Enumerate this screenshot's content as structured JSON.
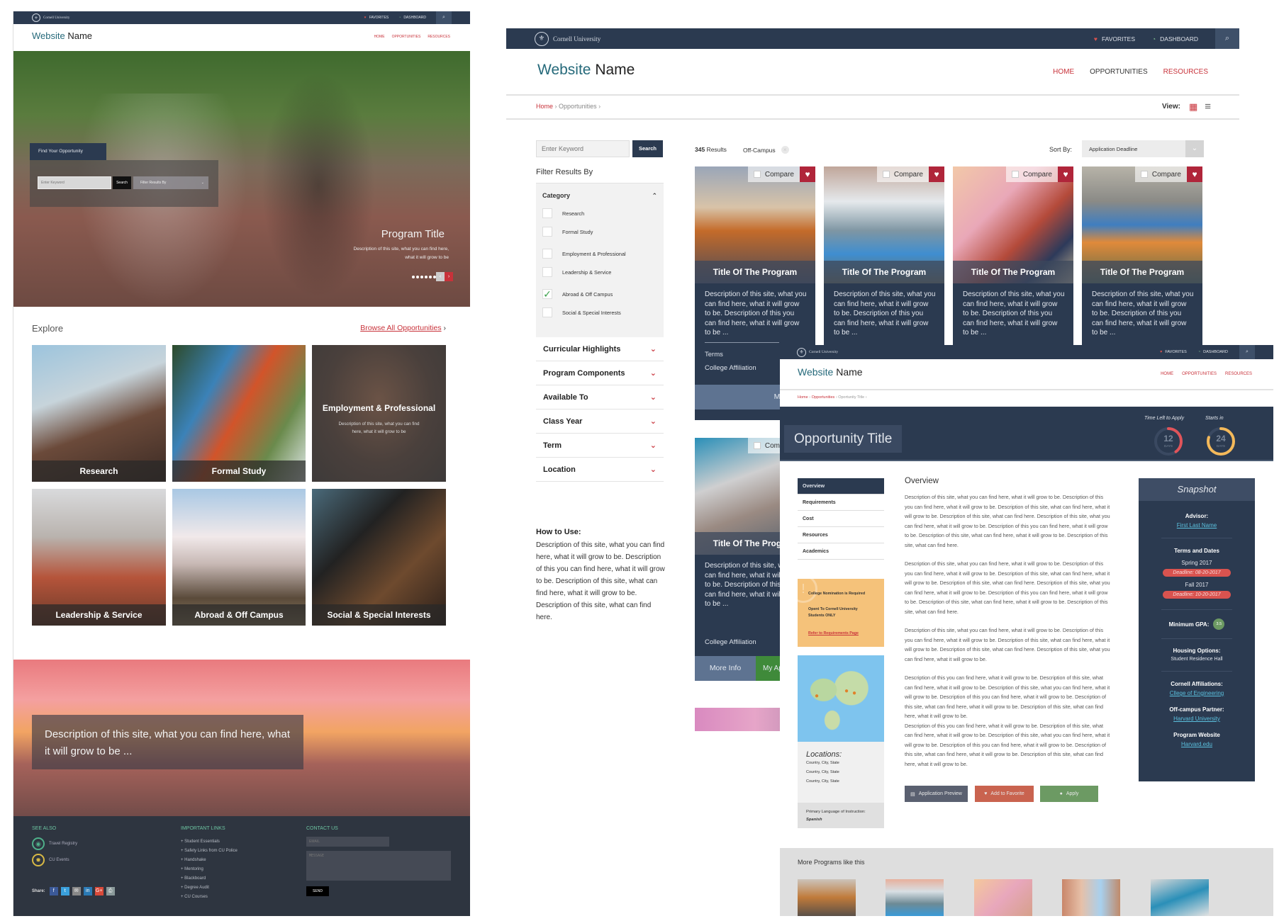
{
  "university": "Cornell University",
  "site": {
    "brand_first": "Website",
    "brand_second": "Name"
  },
  "topbar": {
    "favorites": "FAVORITES",
    "dashboard": "DASHBOARD"
  },
  "nav": [
    "HOME",
    "OPPORTUNITIES",
    "RESOURCES"
  ],
  "colors": {
    "navy": "#2b3a50",
    "accent_red": "#c8323a",
    "teal": "#25697a",
    "warning": "#f5c27a",
    "success": "#6c9a63",
    "link_cyan": "#5bc0de"
  },
  "home": {
    "search_panel": {
      "title": "Find Your Opportunity",
      "keyword_placeholder": "Enter Keyword",
      "search_label": "Search",
      "filter_placeholder": "Filter Results By"
    },
    "hero": {
      "title": "Program Title",
      "description": "Description of this site, what you can find here, what it will grow to be",
      "slides": 6,
      "active_slide": 0
    },
    "explore": {
      "title": "Explore",
      "browse_all": "Browse All Opportunities",
      "tiles": [
        {
          "label": "Research"
        },
        {
          "label": "Formal Study"
        },
        {
          "label": "Employment & Professional",
          "description": "Description of this site, what you can find here, what it will grow to be"
        },
        {
          "label": "Leadership & Service"
        },
        {
          "label": "Abroad & Off Campus"
        },
        {
          "label": "Social & Special Interests"
        }
      ]
    },
    "banner": {
      "text": "Description of this site, what you can find here, what it will grow to be ..."
    },
    "footer": {
      "see_also": {
        "title": "SEE ALSO",
        "items": [
          "Travel Registry",
          "CU Events"
        ]
      },
      "share_label": "Share:",
      "share_icons": [
        "f",
        "t",
        "✉",
        "in",
        "G+",
        "⎙"
      ],
      "important_links": {
        "title": "IMPORTANT LINKS",
        "items": [
          "Student Essentials",
          "Safety Links from CU Police",
          "Handshake",
          "Mentoring",
          "Blackboard",
          "Degree Audit",
          "CU Courses"
        ]
      },
      "contact": {
        "title": "CONTACT US",
        "email_placeholder": "EMAIL",
        "message_placeholder": "MESSAGE",
        "send": "SEND"
      }
    }
  },
  "listing": {
    "breadcrumb": [
      "Home",
      "Opportunities"
    ],
    "view_label": "View:",
    "search": {
      "placeholder": "Enter Keyword",
      "button": "Search"
    },
    "filter_title": "Filter Results By",
    "category": {
      "title": "Category",
      "options": [
        {
          "label": "Research",
          "checked": false
        },
        {
          "label": "Formal Study",
          "checked": false
        },
        {
          "label": "Employment & Professional",
          "checked": false
        },
        {
          "label": "Leadership & Service",
          "checked": false
        },
        {
          "label": "Abroad & Off Campus",
          "checked": true
        },
        {
          "label": "Social & Special Interests",
          "checked": false
        }
      ]
    },
    "collapsed_filters": [
      "Curricular Highlights",
      "Program Components",
      "Available To",
      "Class Year",
      "Term",
      "Location"
    ],
    "how_to": {
      "title": "How to Use:",
      "text": "Description of this site, what you can find here, what it will grow to be. Description of this you can find here, what it will grow to be. Description of this site, what can find here, what it will grow to be. Description of this site, what can find here."
    },
    "results_count": "345",
    "results_label": "Results",
    "active_filter": "Off-Campus",
    "sort_label": "Sort By:",
    "sort_value": "Application Deadline",
    "cards": [
      {
        "title": "Title Of The Program",
        "description": "Description of this site, what you can find here, what it will grow to be. Description of this you can find here, what it will grow to be ...",
        "compare": "Compare",
        "compare_checked": false
      },
      {
        "title": "Title Of The Program",
        "description": "Description of this site, what you can find here, what it will grow to be. Description of this you can find here, what it will grow to be ...",
        "compare": "Compare",
        "compare_checked": false
      },
      {
        "title": "Title Of The Program",
        "description": "Description of this site, what you can find here, what it will grow to be. Description of this you can find here, what it will grow to be ...",
        "compare": "Compare",
        "compare_checked": false
      },
      {
        "title": "Title Of The Program",
        "description": "Description of this site, what you can find here, what it will grow to be. Description of this you can find here, what it will grow to be ...",
        "compare": "Compare",
        "compare_checked": false
      },
      {
        "title": "Title Of The Program",
        "description": "Description of this site, what you can find here, what it will grow to be. Description of this you can find here, what it will grow to be ...",
        "compare": "Compare",
        "compare_checked": false
      },
      {
        "title": "",
        "compare": "Compare",
        "compare_checked": true
      }
    ],
    "card_meta": {
      "terms": "Terms",
      "college": "College Affiliation",
      "more_info": "More Info",
      "my_app": "My Ap"
    }
  },
  "detail": {
    "breadcrumb": [
      "Home",
      "Opportunities",
      "Oportunity Title"
    ],
    "title": "Opportunity Title",
    "time_left": {
      "label": "Time Left to Apply",
      "value": "12",
      "unit": "DAYS",
      "fraction": 0.4
    },
    "starts_in": {
      "label": "Starts in",
      "value": "24",
      "unit": "DAYS",
      "fraction": 0.8
    },
    "sidenav": [
      "Overview",
      "Requirements",
      "Cost",
      "Resources",
      "Academics"
    ],
    "alert": {
      "line1": "College Nomination is Required",
      "line2": "Opent To Cornell University Students ONLY",
      "link": "Refer to Requirements Page"
    },
    "locations": {
      "title": "Locations:",
      "items": [
        "Country, City, State",
        "Country, City, State",
        "Country, City, State"
      ]
    },
    "language": {
      "label": "Primary Language of Instruction:",
      "value": "Spanish"
    },
    "overview_title": "Overview",
    "paragraphs": [
      "Description of this site, what you can find here, what it will grow to be. Description of this you can find here, what it will grow to be. Description of this site, what can find here, what it will grow to be. Description of this site, what can find here. Description of this site, what you can find here, what it will grow to be. Description of this you can find here, what it will grow to be. Description of this site, what can find here, what it will grow to be. Description of this site, what can find here.",
      "Description of this site, what you can find here, what it will grow to be. Description of this you can find here, what it will grow to be. Description of this site, what can find here, what it will grow to be. Description of this site, what can find here. Description of this site, what you can find here, what it will grow to be. Description of this you can find here, what it will grow to be. Description of this site, what can find here, what it will grow to be. Description of this site, what can find here.",
      "Description of this site, what you can find here, what it will grow to be. Description of this you can find here, what it will grow to be. Description of this site, what can find here, what it will grow to be. Description of this site, what can find here. Description of this site, what you can find here, what it will grow to be.",
      "Description of this you can find here, what it will grow to be. Description of this site, what can find here, what it will grow to be. Description of this site, what you can find here, what it will grow to be. Description of this you can find here, what it will grow to be. Description of this site, what can find here, what it will grow to be.  Description of this site, what can find here, what it will grow to be.",
      "Description of this you can find here, what it will grow to be. Description of this site, what can find here, what it will grow to be. Description of this site, what you can find here, what it will grow to be. Description of this you can find here, what it will grow to be. Description of this site, what can find here, what it will grow to be.  Description of this site, what can find here, what it will grow to be."
    ],
    "buttons": {
      "preview": "Application Preview",
      "favorite": "Add to Favorite",
      "apply": "Apply"
    },
    "snapshot": {
      "title": "Snapshot",
      "advisor_label": "Advisor:",
      "advisor": "First Last Name",
      "terms_label": "Terms and Dates",
      "terms": [
        {
          "term": "Spring 2017",
          "deadline": "Deadline: 08-20-2017"
        },
        {
          "term": "Fall 2017",
          "deadline": "Deadline: 10-20-2017"
        }
      ],
      "gpa_label": "Minimum GPA:",
      "gpa": "3.5",
      "housing_label": "Housing Options:",
      "housing": "Student Residence Hall",
      "affiliations_label": "Cornell Affiliations:",
      "affiliation": "Cllege of Engineering",
      "partner_label": "Off-campus Partner:",
      "partner": "Harvard University",
      "website_label": "Program Website",
      "website": "Harvard.edu"
    },
    "more_programs": "More Programs like this"
  }
}
